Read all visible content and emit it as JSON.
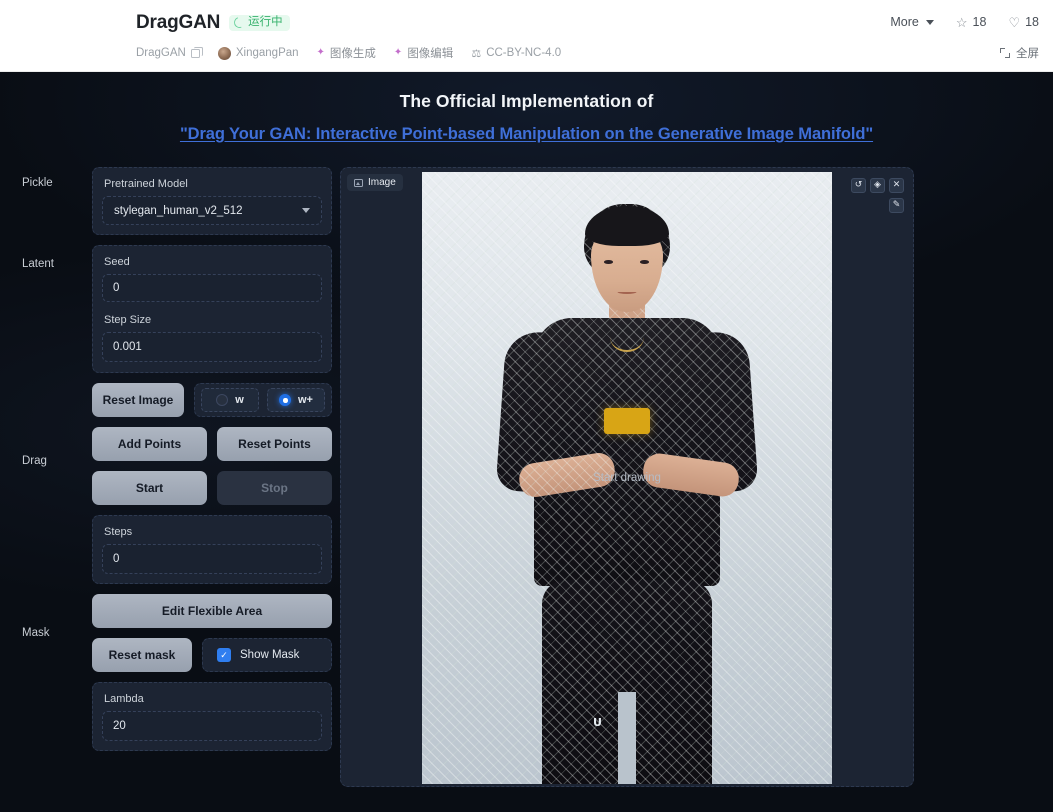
{
  "topbar": {
    "app_title": "DragGAN",
    "status_badge": "运行中",
    "status_icon": "spinner-icon",
    "repo_name": "DragGAN",
    "copy_icon": "copy-icon",
    "author": "XingangPan",
    "avatar_icon": "avatar",
    "tags": [
      {
        "icon": "sparkle-icon",
        "label": "图像生成"
      },
      {
        "icon": "sparkle-icon",
        "label": "图像编辑"
      }
    ],
    "license_icon": "license-icon",
    "license": "CC-BY-NC-4.0",
    "more_label": "More",
    "more_caret_icon": "chevron-down-icon",
    "star_icon": "star-icon",
    "star_count": "18",
    "heart_icon": "heart-icon",
    "heart_count": "18",
    "fullscreen_icon": "fullscreen-icon",
    "fullscreen_label": "全屏"
  },
  "hero": {
    "line1": "The Official Implementation of",
    "line2": "\"Drag Your GAN: Interactive Point-based Manipulation on the Generative Image Manifold\""
  },
  "rail": {
    "pickle": "Pickle",
    "latent": "Latent",
    "drag": "Drag",
    "mask": "Mask"
  },
  "controls": {
    "pretrained_model_label": "Pretrained Model",
    "pretrained_model_value": "stylegan_human_v2_512",
    "seed_label": "Seed",
    "seed_value": "0",
    "step_size_label": "Step Size",
    "step_size_value": "0.001",
    "reset_image_label": "Reset Image",
    "radio_w_label": "w",
    "radio_wplus_label": "w+",
    "add_points_label": "Add Points",
    "reset_points_label": "Reset Points",
    "start_label": "Start",
    "stop_label": "Stop",
    "steps_label": "Steps",
    "steps_value": "0",
    "edit_flexible_area_label": "Edit Flexible Area",
    "reset_mask_label": "Reset mask",
    "show_mask_label": "Show Mask",
    "lambda_label": "Lambda",
    "lambda_value": "20"
  },
  "image_panel": {
    "tag_label": "Image",
    "tag_icon": "image-icon",
    "tools": [
      {
        "icon": "undo-icon",
        "glyph": "↺"
      },
      {
        "icon": "eraser-icon",
        "glyph": "◈"
      },
      {
        "icon": "close-icon",
        "glyph": "✕"
      },
      {
        "icon": "pen-icon",
        "glyph": "✎"
      }
    ],
    "overlay_text": "Start drawing"
  },
  "colors": {
    "accent_blue": "#2f7ef0",
    "link_blue": "#3f6fd8",
    "status_green": "#37b26d",
    "panel_bg": "#1c2433",
    "app_bg": "#090d14"
  }
}
